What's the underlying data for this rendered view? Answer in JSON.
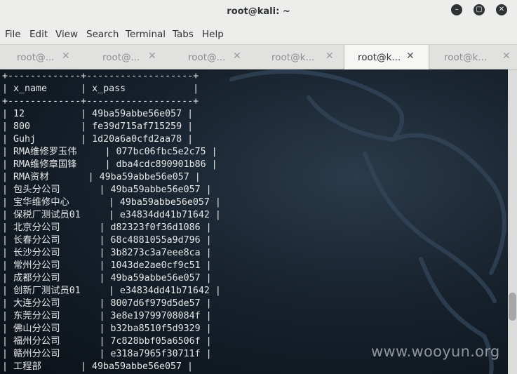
{
  "window": {
    "title": "root@kali: ~"
  },
  "menu": [
    "File",
    "Edit",
    "View",
    "Search",
    "Terminal",
    "Tabs",
    "Help"
  ],
  "tabs": [
    {
      "label": "root@...",
      "active": false
    },
    {
      "label": "root@...",
      "active": false
    },
    {
      "label": "root@...",
      "active": false
    },
    {
      "label": "root@k...",
      "active": false
    },
    {
      "label": "root@k...",
      "active": true
    },
    {
      "label": "root@k...",
      "active": false
    }
  ],
  "terminal": {
    "lines": [
      "+-------------+-------------------+",
      "| x_name      | x_pass            |",
      "+-------------+-------------------+",
      "| 12          | 49ba59abbe56e057 |",
      "| 800         | fe39d715af715259 |",
      "| Guhj        | 1d20a6a0cfd2aa78 |",
      "| RMA维修罗玉伟     | 077bc06fbc5e2c75 |",
      "| RMA维修章国锋     | dba4cdc890901b86 |",
      "| RMA资材       | 49ba59abbe56e057 |",
      "| 包头分公司       | 49ba59abbe56e057 |",
      "| 宝华维修中心       | 49ba59abbe56e057 |",
      "| 保税厂测试员01     | e34834dd41b71642 |",
      "| 北京分公司       | d82323f0f36d1086 |",
      "| 长春分公司       | 68c4881055a9d796 |",
      "| 长沙分公司       | 3b8273c3a7eee8ca |",
      "| 常州分公司       | 1043de2ae0cf9c51 |",
      "| 成都分公司       | 49ba59abbe56e057 |",
      "| 创新厂测试员01     | e34834dd41b71642 |",
      "| 大连分公司       | 8007d6f979d5de57 |",
      "| 东莞分公司       | 3e8e19799708084f |",
      "| 佛山分公司       | b32ba8510f5d9329 |",
      "| 福州分公司       | 7c828bbf05a6506f |",
      "| 赣州分公司       | e318a7965f30711f |",
      "| 工程部       | 49ba59abbe56e057 |"
    ]
  },
  "watermark": "www.wooyun.org",
  "colors": {
    "terminal_bg": "#17222d",
    "terminal_text": "#e6e6e6",
    "chrome": "#ededec"
  }
}
